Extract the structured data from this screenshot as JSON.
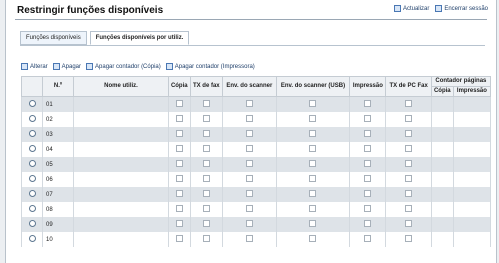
{
  "header": {
    "title": "Restringir funções disponíveis",
    "update_label": "Actualizar",
    "logout_label": "Encerrar sessão"
  },
  "tabs": [
    {
      "label": "Funções disponíveis",
      "active": false
    },
    {
      "label": "Funções disponíveis por utiliz.",
      "active": true
    }
  ],
  "actions": [
    {
      "label": "Alterar",
      "icon": "edit-icon"
    },
    {
      "label": "Apagar",
      "icon": "delete-icon"
    },
    {
      "label": "Apagar contador (Cópia)",
      "icon": "copy-counter-icon"
    },
    {
      "label": "Apagar contador (Impressora)",
      "icon": "printer-counter-icon"
    }
  ],
  "table": {
    "headers": {
      "number": "N.º",
      "user_name": "Nome utiliz.",
      "copy": "Cópia",
      "fax_tx": "TX de fax",
      "scan_send": "Env. do scanner",
      "scan_usb": "Env. do scanner (USB)",
      "print": "Impressão",
      "pcfax_tx": "TX de PC Fax",
      "page_counter": "Contador páginas",
      "counter_copy": "Cópia",
      "counter_print": "Impressão"
    },
    "rows": [
      {
        "number": "01"
      },
      {
        "number": "02"
      },
      {
        "number": "03"
      },
      {
        "number": "04"
      },
      {
        "number": "05"
      },
      {
        "number": "06"
      },
      {
        "number": "07"
      },
      {
        "number": "08"
      },
      {
        "number": "09"
      },
      {
        "number": "10"
      }
    ]
  }
}
